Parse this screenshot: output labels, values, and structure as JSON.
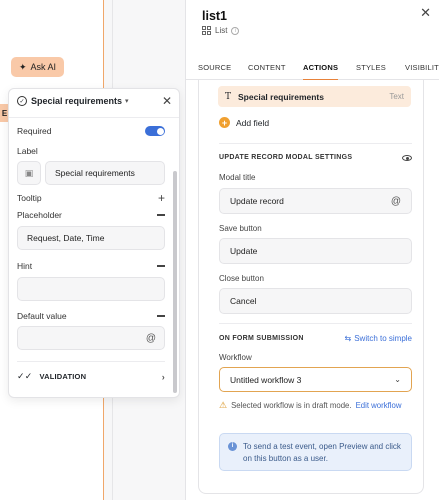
{
  "canvas": {
    "ask_ai_label": "Ask AI",
    "tag_letter": "E"
  },
  "popup": {
    "title": "Special requirements",
    "required_label": "Required",
    "required_on": true,
    "label_label": "Label",
    "label_value": "Special requirements",
    "tooltip_label": "Tooltip",
    "placeholder_label": "Placeholder",
    "placeholder_value": "Request, Date, Time",
    "hint_label": "Hint",
    "hint_value": "",
    "default_label": "Default value",
    "default_value": "",
    "validation_label": "VALIDATION"
  },
  "panel": {
    "title": "list1",
    "subtitle": "List",
    "tabs": [
      "SOURCE",
      "CONTENT",
      "ACTIONS",
      "STYLES",
      "VISIBILITY"
    ],
    "active_tab": "ACTIONS",
    "field_chip": {
      "name": "Special requirements",
      "type": "Text"
    },
    "add_field": "Add field",
    "modal_section": "UPDATE RECORD MODAL SETTINGS",
    "modal_title_label": "Modal title",
    "modal_title_value": "Update record",
    "save_button_label": "Save button",
    "save_button_value": "Update",
    "close_button_label": "Close button",
    "close_button_value": "Cancel",
    "submission_section": "ON FORM SUBMISSION",
    "switch_link": "Switch to simple",
    "workflow_label": "Workflow",
    "workflow_value": "Untitled workflow 3",
    "warning_text": "Selected workflow is in draft mode.",
    "warning_link": "Edit workflow",
    "info_text": "To send a test event, open Preview and click on this button as a user."
  },
  "colors": {
    "accent_orange": "#e8823a",
    "toggle_blue": "#3b6fd8",
    "chip_bg": "#fcebdc"
  }
}
